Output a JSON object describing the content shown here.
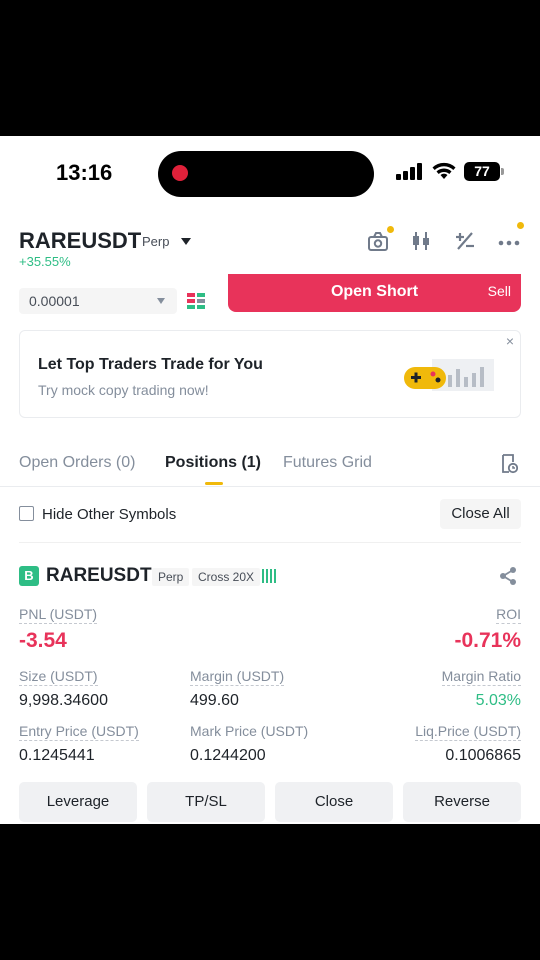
{
  "status_bar": {
    "time": "13:16",
    "battery": "77"
  },
  "header": {
    "symbol": "RAREUSDT",
    "contract_type": "Perp",
    "change_pct": "+35.55%",
    "icons": [
      "bot-icon",
      "candlestick-icon",
      "percent-icon",
      "more-icon"
    ]
  },
  "order": {
    "quantity": "0.00001",
    "open_short_label": "Open Short",
    "sell_label": "Sell"
  },
  "banner": {
    "title": "Let Top Traders Trade for You",
    "subtitle": "Try mock copy trading now!",
    "close_glyph": "×"
  },
  "tabs": [
    {
      "label": "Open Orders (0)",
      "active": false
    },
    {
      "label": "Positions (1)",
      "active": true
    },
    {
      "label": "Futures Grid",
      "active": false
    }
  ],
  "filter": {
    "hide_label": "Hide Other Symbols",
    "hide_checked": false,
    "close_all_label": "Close All"
  },
  "position": {
    "side_badge": "B",
    "symbol": "RAREUSDT",
    "contract_type": "Perp",
    "margin_mode": "Cross 20X",
    "pnl_label": "PNL (USDT)",
    "pnl_value": "-3.54",
    "roi_label": "ROI",
    "roi_value": "-0.71%",
    "size_label": "Size (USDT)",
    "size_value": "9,998.34600",
    "margin_label": "Margin (USDT)",
    "margin_value": "499.60",
    "margin_ratio_label": "Margin Ratio",
    "margin_ratio_value": "5.03%",
    "entry_label": "Entry Price (USDT)",
    "entry_value": "0.1245441",
    "mark_label": "Mark Price (USDT)",
    "mark_value": "0.1244200",
    "liq_label": "Liq.Price (USDT)",
    "liq_value": "0.1006865"
  },
  "actions": {
    "leverage": "Leverage",
    "tpsl": "TP/SL",
    "close": "Close",
    "reverse": "Reverse"
  },
  "colors": {
    "accent": "#f0b90b",
    "sell": "#e8335a",
    "buy": "#2ebd85"
  }
}
